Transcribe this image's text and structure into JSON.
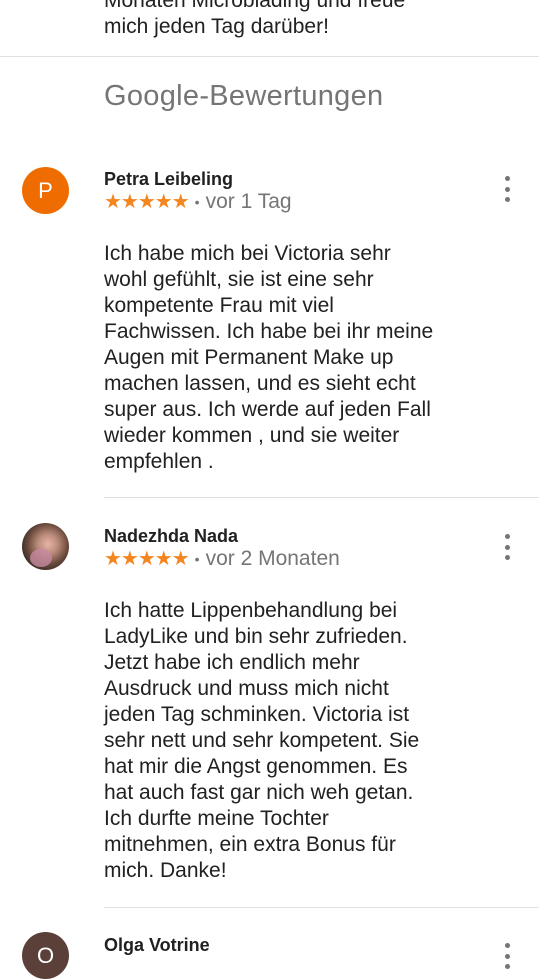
{
  "previous_review": {
    "lines": [
      "Monaten Microblading und freue",
      "mich jeden Tag darüber!"
    ]
  },
  "section": {
    "title": "Google-Bewertungen"
  },
  "reviews": [
    {
      "avatar_letter": "P",
      "name": "Petra Leibeling",
      "stars": "★★★★★",
      "separator": "•",
      "date": "vor 1 Tag",
      "lines": [
        "Ich habe mich bei Victoria sehr",
        "wohl gefühlt, sie ist eine sehr",
        "kompetente Frau mit viel",
        "Fachwissen. Ich habe bei ihr meine",
        "Augen mit Permanent Make up",
        "machen lassen, und es sieht echt",
        "super aus. Ich werde auf jeden Fall",
        "wieder kommen , und sie weiter",
        "empfehlen ."
      ]
    },
    {
      "avatar_letter": "",
      "name": "Nadezhda Nada",
      "stars": "★★★★★",
      "separator": "•",
      "date": "vor 2 Monaten",
      "lines": [
        "Ich hatte Lippenbehandlung bei",
        "LadyLike und bin sehr zufrieden.",
        "Jetzt habe ich endlich mehr",
        "Ausdruck und muss mich nicht",
        "jeden Tag schminken. Victoria ist",
        "sehr nett und sehr kompetent. Sie",
        "hat mir die Angst genommen. Es",
        "hat auch fast gar nich weh getan.",
        "Ich durfte meine Tochter",
        "mitnehmen, ein extra Bonus für",
        "mich. Danke!"
      ]
    },
    {
      "avatar_letter": "O",
      "name": "Olga Votrine"
    }
  ],
  "colors": {
    "star": "#f5851f",
    "avatar_p": "#ef6c00",
    "secondary_text": "#757575",
    "divider": "#e0e0e0"
  },
  "icons": [
    "more-vert-icon"
  ]
}
